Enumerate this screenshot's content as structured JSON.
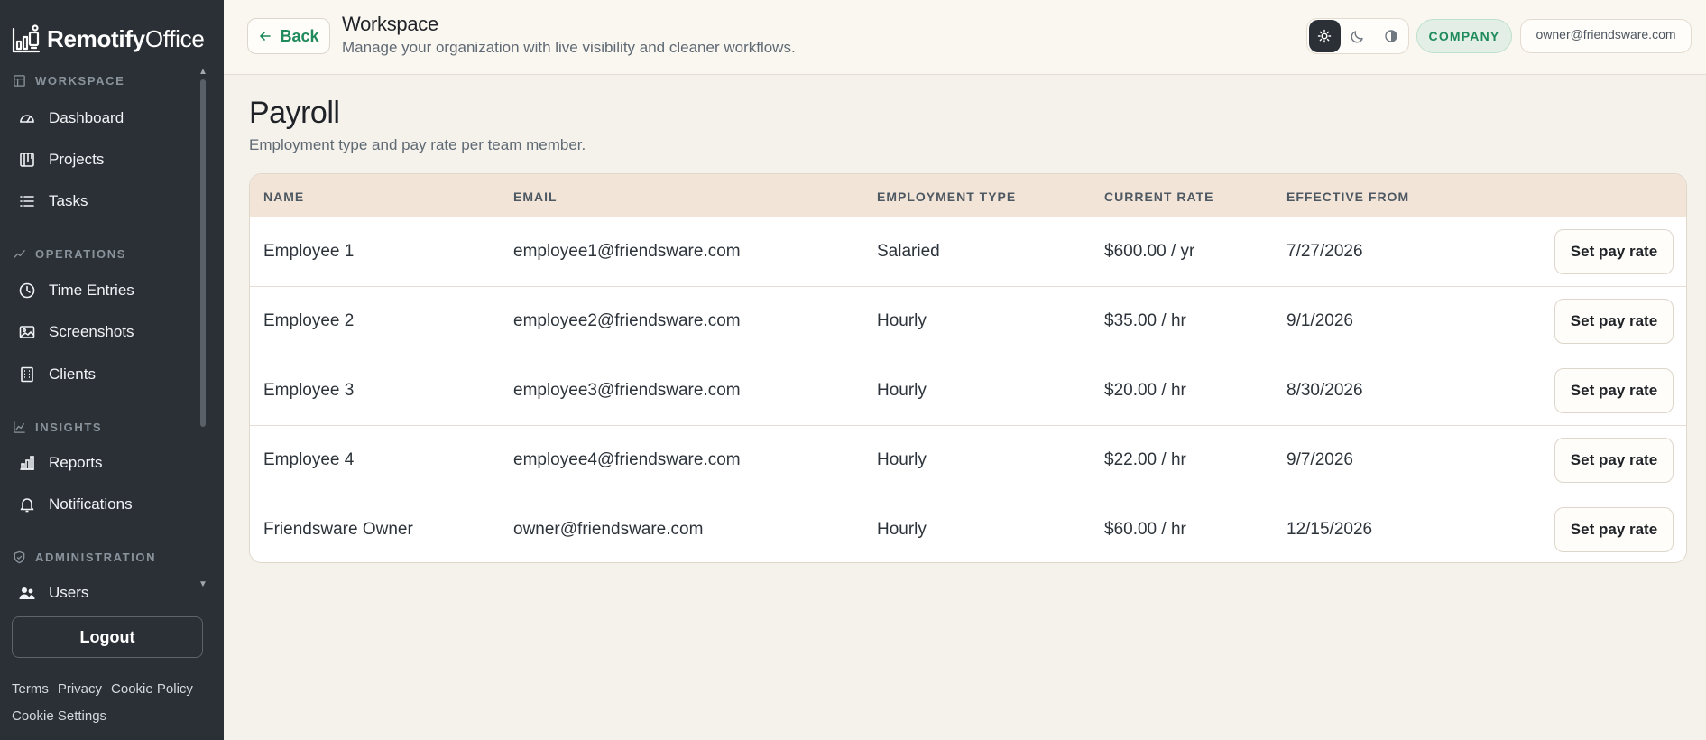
{
  "brand": {
    "name_bold": "Remotify",
    "name_light": "Office"
  },
  "sidebar": {
    "sections": [
      {
        "label": "WORKSPACE",
        "icon": "layout-icon"
      },
      {
        "label": "OPERATIONS",
        "icon": "sparkle-icon"
      },
      {
        "label": "INSIGHTS",
        "icon": "trend-icon"
      },
      {
        "label": "ADMINISTRATION",
        "icon": "shield-icon"
      }
    ],
    "items": [
      {
        "label": "Dashboard",
        "icon": "gauge-icon"
      },
      {
        "label": "Projects",
        "icon": "board-icon"
      },
      {
        "label": "Tasks",
        "icon": "list-icon"
      },
      {
        "label": "Time Entries",
        "icon": "clock-icon"
      },
      {
        "label": "Screenshots",
        "icon": "image-icon"
      },
      {
        "label": "Clients",
        "icon": "building-icon"
      },
      {
        "label": "Reports",
        "icon": "bar-chart-icon"
      },
      {
        "label": "Notifications",
        "icon": "bell-icon"
      },
      {
        "label": "Users",
        "icon": "users-icon"
      }
    ],
    "logout_label": "Logout",
    "footer_links": [
      "Terms",
      "Privacy",
      "Cookie Policy",
      "Cookie Settings"
    ]
  },
  "header": {
    "back_label": "Back",
    "title": "Workspace",
    "subtitle": "Manage your organization with live visibility and cleaner workflows.",
    "theme_options": [
      "light-icon",
      "dark-icon",
      "contrast-icon"
    ],
    "company_badge": "COMPANY",
    "user_email": "owner@friendsware.com"
  },
  "page": {
    "title": "Payroll",
    "subtitle": "Employment type and pay rate per team member."
  },
  "table": {
    "headers": [
      "NAME",
      "EMAIL",
      "EMPLOYMENT TYPE",
      "CURRENT RATE",
      "EFFECTIVE FROM"
    ],
    "action_label": "Set pay rate",
    "rows": [
      {
        "name": "Employee 1",
        "email": "employee1@friendsware.com",
        "type": "Salaried",
        "rate": "$600.00 / yr",
        "effective": "7/27/2026"
      },
      {
        "name": "Employee 2",
        "email": "employee2@friendsware.com",
        "type": "Hourly",
        "rate": "$35.00 / hr",
        "effective": "9/1/2026"
      },
      {
        "name": "Employee 3",
        "email": "employee3@friendsware.com",
        "type": "Hourly",
        "rate": "$20.00 / hr",
        "effective": "8/30/2026"
      },
      {
        "name": "Employee 4",
        "email": "employee4@friendsware.com",
        "type": "Hourly",
        "rate": "$22.00 / hr",
        "effective": "9/7/2026"
      },
      {
        "name": "Friendsware Owner",
        "email": "owner@friendsware.com",
        "type": "Hourly",
        "rate": "$60.00 / hr",
        "effective": "12/15/2026"
      }
    ]
  },
  "colors": {
    "accent": "#1f8a5b",
    "sidebar_bg": "#2b3036",
    "header_row": "#f2e5d8",
    "page_bg": "#f5f1eb"
  }
}
